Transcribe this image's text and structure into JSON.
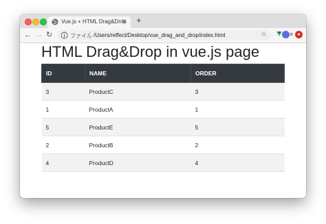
{
  "browser": {
    "tab_title": "Vue.js + HTML Drag&Drop",
    "address_label": "ファイル",
    "url": "/Users/reffect/Desktop/vue_drag_and_drop/index.html",
    "icons": [
      "back-icon",
      "forward-icon",
      "reload-icon",
      "info-icon",
      "star-icon",
      "vue-devtools-icon",
      "reading-list-icon",
      "profile-avatar",
      "extension-icon"
    ]
  },
  "page": {
    "title": "HTML Drag&Drop in vue.js page"
  },
  "table": {
    "columns": [
      "ID",
      "NAME",
      "ORDER"
    ],
    "rows": [
      {
        "id": "3",
        "name": "ProductC",
        "order": "3"
      },
      {
        "id": "1",
        "name": "ProductA",
        "order": "1"
      },
      {
        "id": "5",
        "name": "ProductE",
        "order": "5"
      },
      {
        "id": "2",
        "name": "ProductB",
        "order": "2"
      },
      {
        "id": "4",
        "name": "ProductD",
        "order": "4"
      }
    ]
  },
  "colors": {
    "header_bg": "#343a40",
    "striped_row": "#f2f2f2",
    "vue_green": "#41b883"
  }
}
